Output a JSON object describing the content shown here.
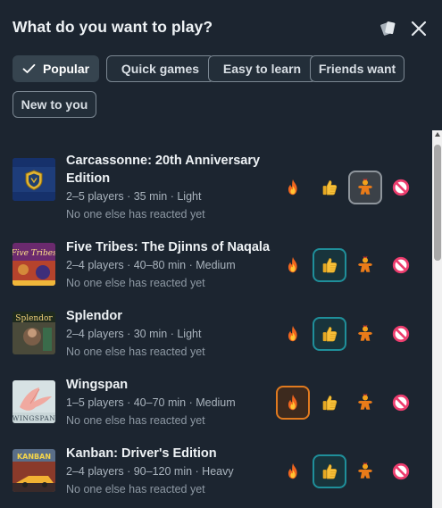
{
  "header": {
    "title": "What do you want to play?"
  },
  "filters": [
    {
      "label": "Popular",
      "selected": true
    },
    {
      "label": "Quick games",
      "selected": false
    },
    {
      "label": "Easy to learn",
      "selected": false
    },
    {
      "label": "Friends want",
      "selected": false
    },
    {
      "label": "New to you",
      "selected": false
    }
  ],
  "games": [
    {
      "title": "Carcassonne: 20th Anniversary Edition",
      "meta": "2–5 players · 35 min · Light",
      "reactions": "No one else has reacted yet",
      "selected_reaction": "meeple"
    },
    {
      "title": "Five Tribes: The Djinns of Naqala",
      "meta": "2–4 players · 40–80 min · Medium",
      "reactions": "No one else has reacted yet",
      "selected_reaction": "thumbs-up"
    },
    {
      "title": "Splendor",
      "meta": "2–4 players · 30 min · Light",
      "reactions": "No one else has reacted yet",
      "selected_reaction": "thumbs-up"
    },
    {
      "title": "Wingspan",
      "meta": "1–5 players · 40–70 min · Medium",
      "reactions": "No one else has reacted yet",
      "selected_reaction": "fire"
    },
    {
      "title": "Kanban: Driver's Edition",
      "meta": "2–4 players · 90–120 min · Heavy",
      "reactions": "No one else has reacted yet",
      "selected_reaction": "thumbs-up"
    }
  ],
  "thumb_text": {
    "five_tribes": "Five Tribes",
    "splendor": "Splendor",
    "wingspan": "WINGSPAN",
    "kanban": "KANBAN"
  },
  "icons": [
    "cards-icon",
    "close-icon",
    "check-icon",
    "fire-icon",
    "thumbs-up-icon",
    "meeple-icon",
    "no-icon"
  ],
  "colors": {
    "background": "#1c2530",
    "chip_border": "#7b8792",
    "selected_teal": "#1f8f9a",
    "selected_orange": "#e07a1f"
  }
}
